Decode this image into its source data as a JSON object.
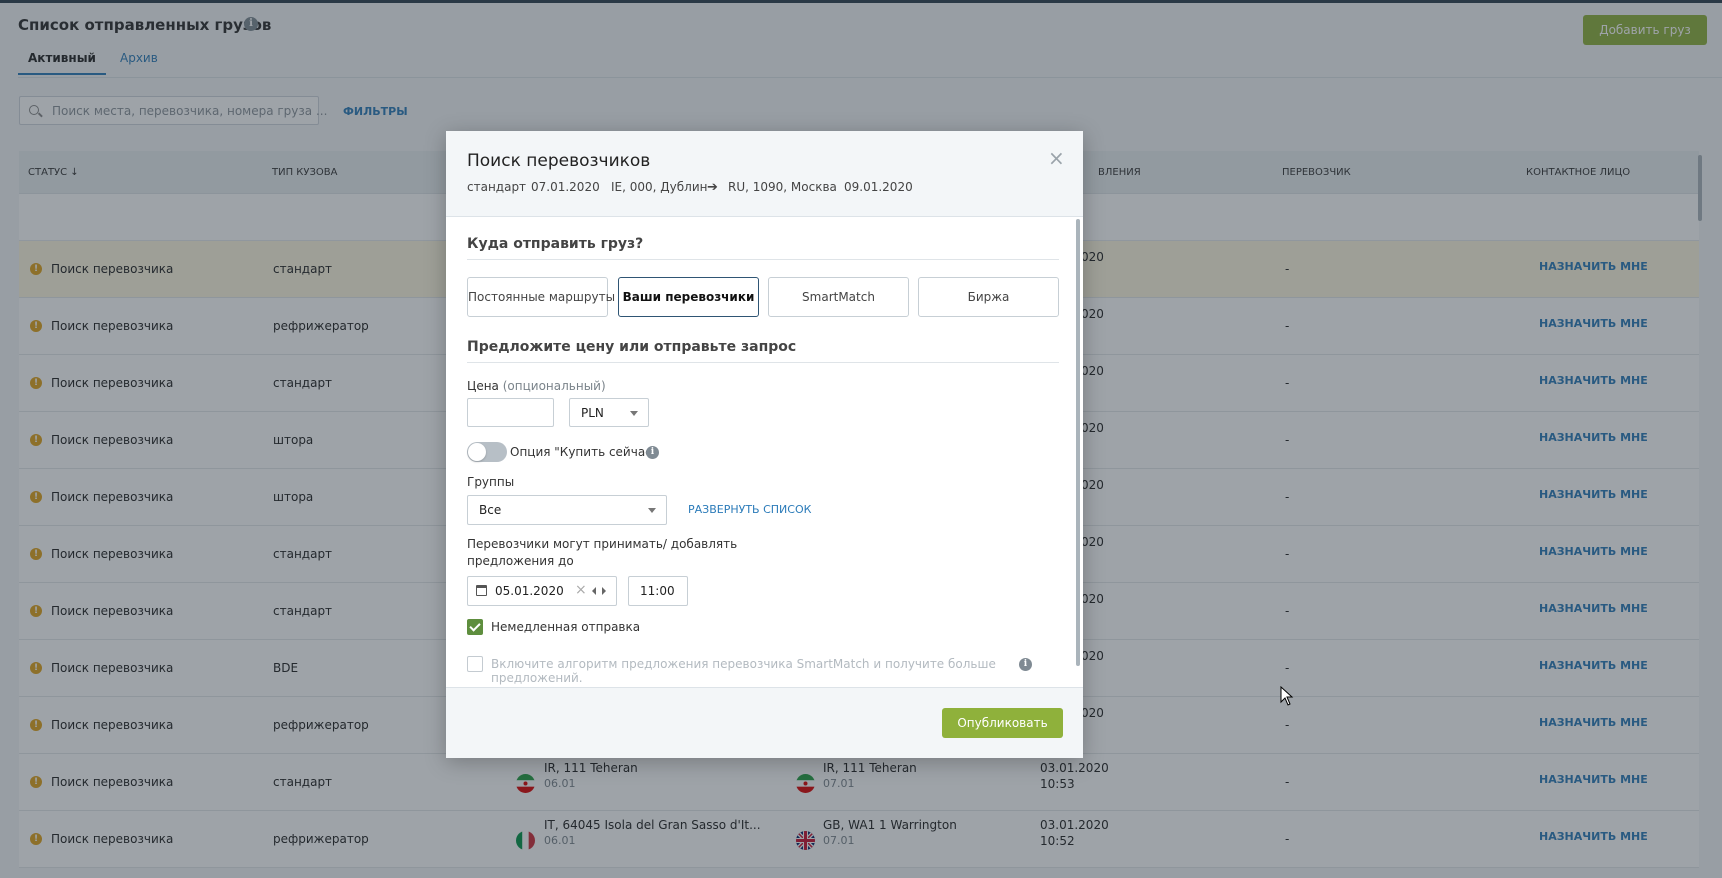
{
  "page": {
    "title": "Список отправленных грузов",
    "add_button": "Добавить груз",
    "tabs": [
      "Активный",
      "Архив"
    ],
    "search_placeholder": "Поиск места, перевозчика, номера груза ...",
    "filters_link": "ФИЛЬТРЫ"
  },
  "table": {
    "headers": {
      "status": "СТАТУС ↓",
      "body_type": "ТИП КУЗОВА",
      "added": "ВЛЕНИЯ",
      "carrier": "ПЕРЕВОЗЧИК",
      "contact": "КОНТАКТНОЕ ЛИЦО"
    },
    "rows": [
      {
        "status": "Поиск перевозчика",
        "body": "стандарт",
        "date": "020",
        "carrier": "-",
        "action": "НАЗНАЧИТЬ МНЕ"
      },
      {
        "status": "Поиск перевозчика",
        "body": "рефрижератор",
        "date": "020",
        "carrier": "-",
        "action": "НАЗНАЧИТЬ МНЕ"
      },
      {
        "status": "Поиск перевозчика",
        "body": "стандарт",
        "date": "020",
        "carrier": "-",
        "action": "НАЗНАЧИТЬ МНЕ"
      },
      {
        "status": "Поиск перевозчика",
        "body": "штора",
        "date": "020",
        "carrier": "-",
        "action": "НАЗНАЧИТЬ МНЕ"
      },
      {
        "status": "Поиск перевозчика",
        "body": "штора",
        "date": "020",
        "carrier": "-",
        "action": "НАЗНАЧИТЬ МНЕ"
      },
      {
        "status": "Поиск перевозчика",
        "body": "стандарт",
        "date": "020",
        "carrier": "-",
        "action": "НАЗНАЧИТЬ МНЕ"
      },
      {
        "status": "Поиск перевозчика",
        "body": "стандарт",
        "date": "020",
        "carrier": "-",
        "action": "НАЗНАЧИТЬ МНЕ"
      },
      {
        "status": "Поиск перевозчика",
        "body": "BDE",
        "date": "020",
        "carrier": "-",
        "action": "НАЗНАЧИТЬ МНЕ"
      },
      {
        "status": "Поиск перевозчика",
        "body": "рефрижератор",
        "date": "020",
        "carrier": "-",
        "action": "НАЗНАЧИТЬ МНЕ"
      },
      {
        "status": "Поиск перевозчика",
        "body": "стандарт",
        "from": "IR, 111 Teheran",
        "from_date": "06.01",
        "to": "IR, 111 Teheran",
        "to_date": "07.01",
        "date": "03.01.2020",
        "time": "10:53",
        "carrier": "-",
        "action": "НАЗНАЧИТЬ МНЕ"
      },
      {
        "status": "Поиск перевозчика",
        "body": "рефрижератор",
        "from": "IT, 64045 Isola del Gran Sasso d'It...",
        "from_date": "06.01",
        "to": "GB, WA1 1 Warrington",
        "to_date": "07.01",
        "date": "03.01.2020",
        "time": "10:52",
        "carrier": "-",
        "action": "НАЗНАЧИТЬ МНЕ"
      }
    ]
  },
  "modal": {
    "title": "Поиск перевозчиков",
    "close": "×",
    "meta": {
      "body": "стандарт",
      "date_from": "07.01.2020",
      "origin": "IE, 000, Дублин",
      "destination": "RU, 1090, Москва",
      "date_to": "09.01.2020"
    },
    "section1": "Куда отправить груз?",
    "targets": [
      "Постоянные маршруты",
      "Ваши перевозчики",
      "SmartMatch",
      "Биржа"
    ],
    "active_target": "Ваши перевозчики",
    "section2": "Предложите цену или отправьте запрос",
    "price_label": "Цена",
    "price_optional": "(опциональный)",
    "price_value": "",
    "currency": "PLN",
    "buy_now_label": "Опция \"Купить сейчас\"",
    "buy_now_on": false,
    "groups_label": "Группы",
    "groups_value": "Все",
    "expand_link": "РАЗВЕРНУТЬ СПИСОК",
    "deadline_label_1": "Перевозчики могут принимать/ добавлять",
    "deadline_label_2": "предложения до",
    "deadline_date": "05.01.2020",
    "deadline_time": "11:00",
    "immediate_label": "Немедленная отправка",
    "immediate_checked": true,
    "smartmatch_label": "Включите алгоритм предложения перевозчика SmartMatch и получите больше предложений.",
    "smartmatch_checked": false,
    "publish_button": "Опубликовать"
  },
  "colors": {
    "accent_green": "#8fb13b",
    "link_blue": "#2b7bb9",
    "warning": "#e0a21b",
    "highlight_row": "#fff8e1"
  }
}
